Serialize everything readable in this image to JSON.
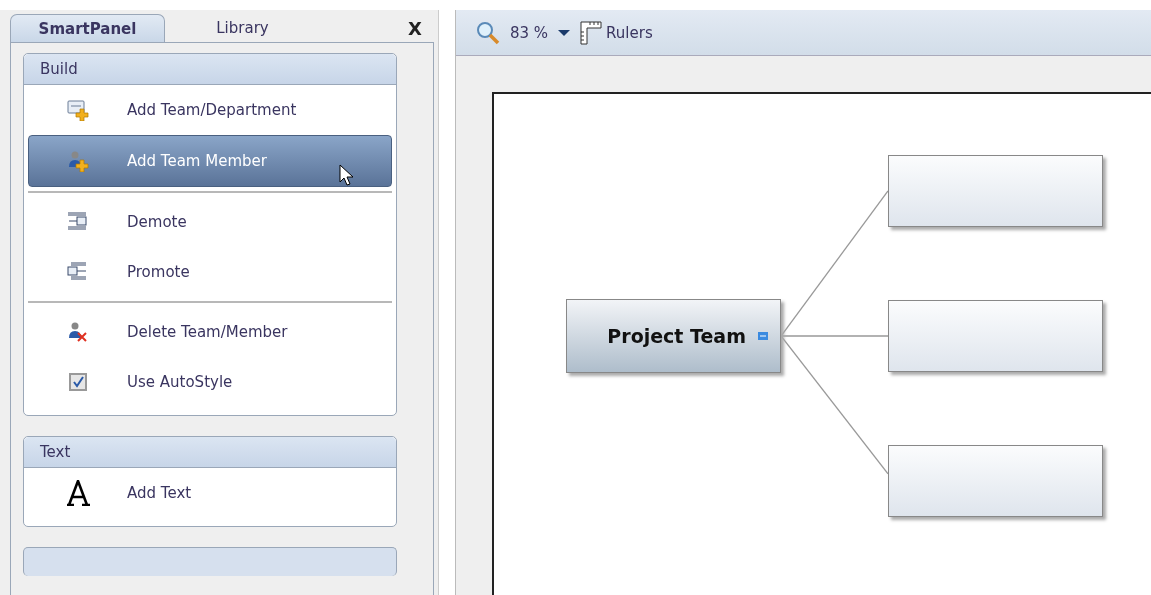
{
  "side_panel": {
    "tabs": [
      {
        "label": "SmartPanel",
        "selected": true
      },
      {
        "label": "Library",
        "selected": false
      }
    ],
    "close": "X",
    "sections": [
      {
        "title": "Build",
        "groups": [
          [
            {
              "kind": "add-team",
              "label": "Add Team/Department",
              "selected": false
            },
            {
              "kind": "add-member",
              "label": "Add Team Member",
              "selected": true
            }
          ],
          [
            {
              "kind": "demote",
              "label": "Demote",
              "selected": false
            },
            {
              "kind": "promote",
              "label": "Promote",
              "selected": false
            }
          ],
          [
            {
              "kind": "delete",
              "label": "Delete Team/Member",
              "selected": false
            },
            {
              "kind": "checkbox",
              "label": "Use AutoStyle",
              "selected": false,
              "checked": true
            }
          ]
        ]
      },
      {
        "title": "Text",
        "groups": [
          [
            {
              "kind": "text",
              "label": "Add Text",
              "selected": false
            }
          ]
        ]
      }
    ]
  },
  "toolbar": {
    "zoom": "83 %",
    "rulers": "Rulers"
  },
  "diagram": {
    "root": {
      "label": "Project Team",
      "expanded": true
    },
    "children": [
      {
        "kind": "box"
      },
      {
        "kind": "box"
      },
      {
        "kind": "box"
      }
    ]
  }
}
